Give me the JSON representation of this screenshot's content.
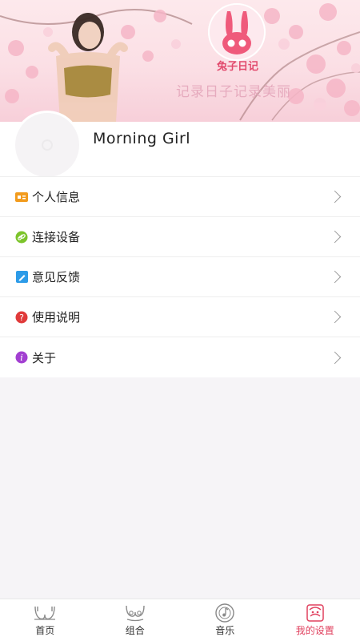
{
  "banner": {
    "brand_name": "兔子日记",
    "slogan": "记录日子记录美丽"
  },
  "profile": {
    "username": "Morning Girl"
  },
  "menu": {
    "items": [
      {
        "label": "个人信息",
        "icon": "id-card-icon",
        "color": "#f29b1d"
      },
      {
        "label": "连接设备",
        "icon": "link-icon",
        "color": "#7cc42b"
      },
      {
        "label": "意见反馈",
        "icon": "pencil-icon",
        "color": "#2c9be8"
      },
      {
        "label": "使用说明",
        "icon": "question-icon",
        "color": "#e03a3a"
      },
      {
        "label": "关于",
        "icon": "info-icon",
        "color": "#a23fd1"
      }
    ]
  },
  "tabbar": {
    "tabs": [
      {
        "label": "首页",
        "icon": "bra-outline-icon",
        "active": false
      },
      {
        "label": "组合",
        "icon": "bra-combo-icon",
        "active": false
      },
      {
        "label": "音乐",
        "icon": "music-disc-icon",
        "active": false
      },
      {
        "label": "我的设置",
        "icon": "profile-settings-icon",
        "active": true
      }
    ],
    "active_color": "#e0405e"
  }
}
